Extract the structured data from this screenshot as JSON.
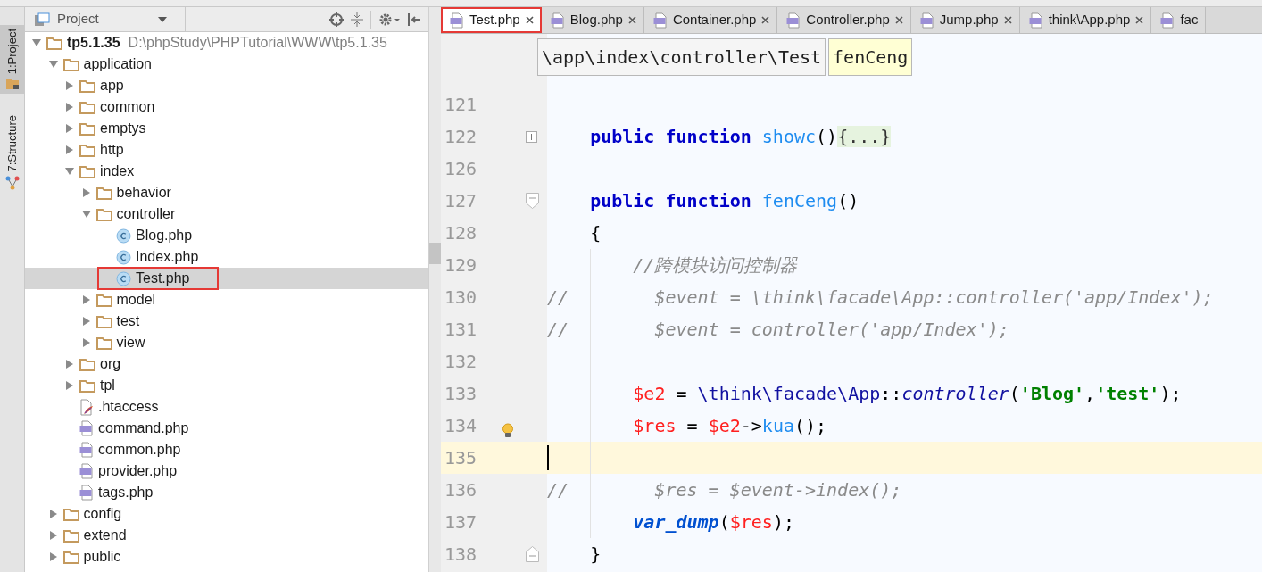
{
  "tool_strip": [
    {
      "label": "1:Project",
      "selected": true
    },
    {
      "label": "7:Structure",
      "selected": false
    }
  ],
  "project_panel": {
    "title": "Project",
    "tree": [
      {
        "name": "tp5.1.35",
        "path": "D:\\phpStudy\\PHPTutorial\\WWW\\tp5.1.35",
        "kind": "folder",
        "expanded": true,
        "selected": false,
        "children": [
          {
            "name": "application",
            "kind": "folder",
            "expanded": true,
            "selected": false,
            "children": [
              {
                "name": "app",
                "kind": "folder",
                "expanded": false,
                "selected": false
              },
              {
                "name": "common",
                "kind": "folder",
                "expanded": false,
                "selected": false
              },
              {
                "name": "emptys",
                "kind": "folder",
                "expanded": false,
                "selected": false
              },
              {
                "name": "http",
                "kind": "folder",
                "expanded": false,
                "selected": false
              },
              {
                "name": "index",
                "kind": "folder",
                "expanded": true,
                "selected": false,
                "children": [
                  {
                    "name": "behavior",
                    "kind": "folder",
                    "expanded": false,
                    "selected": false
                  },
                  {
                    "name": "controller",
                    "kind": "folder",
                    "expanded": true,
                    "selected": false,
                    "children": [
                      {
                        "name": "Blog.php",
                        "kind": "class",
                        "selected": false
                      },
                      {
                        "name": "Index.php",
                        "kind": "class",
                        "selected": false
                      },
                      {
                        "name": "Test.php",
                        "kind": "class",
                        "selected": true,
                        "annotated": true
                      }
                    ]
                  },
                  {
                    "name": "model",
                    "kind": "folder",
                    "expanded": false,
                    "selected": false
                  },
                  {
                    "name": "test",
                    "kind": "folder",
                    "expanded": false,
                    "selected": false
                  },
                  {
                    "name": "view",
                    "kind": "folder",
                    "expanded": false,
                    "selected": false
                  }
                ]
              },
              {
                "name": "org",
                "kind": "folder",
                "expanded": false,
                "selected": false
              },
              {
                "name": "tpl",
                "kind": "folder",
                "expanded": false,
                "selected": false
              },
              {
                "name": ".htaccess",
                "kind": "htaccess",
                "selected": false
              },
              {
                "name": "command.php",
                "kind": "php",
                "selected": false
              },
              {
                "name": "common.php",
                "kind": "php",
                "selected": false
              },
              {
                "name": "provider.php",
                "kind": "php",
                "selected": false
              },
              {
                "name": "tags.php",
                "kind": "php",
                "selected": false
              }
            ]
          },
          {
            "name": "config",
            "kind": "folder",
            "expanded": false,
            "selected": false
          },
          {
            "name": "extend",
            "kind": "folder",
            "expanded": false,
            "selected": false
          },
          {
            "name": "public",
            "kind": "folder",
            "expanded": false,
            "selected": false
          }
        ]
      }
    ]
  },
  "editor": {
    "tabs": [
      {
        "label": "Test.php",
        "selected": true,
        "annotated": true
      },
      {
        "label": "Blog.php",
        "selected": false,
        "annotated": false
      },
      {
        "label": "Container.php",
        "selected": false,
        "annotated": false
      },
      {
        "label": "Controller.php",
        "selected": false,
        "annotated": false
      },
      {
        "label": "Jump.php",
        "selected": false,
        "annotated": false
      },
      {
        "label": "think\\App.php",
        "selected": false,
        "annotated": false
      },
      {
        "label": "fac",
        "selected": false,
        "annotated": false
      }
    ],
    "breadcrumbs": [
      {
        "label": "\\app\\index\\controller\\Test",
        "selected": false
      },
      {
        "label": "fenCeng",
        "selected": true
      }
    ],
    "lines": [
      {
        "number": "121"
      },
      {
        "number": "122",
        "fold": {
          "kind": "collapsed"
        },
        "tokens": [
          {
            "kind": "kw",
            "text": "    public function "
          },
          {
            "kind": "fn",
            "text": "showc"
          },
          {
            "kind": "plain",
            "text": "()"
          },
          {
            "kind": "folded",
            "text": "{...}"
          }
        ]
      },
      {
        "number": "126"
      },
      {
        "number": "127",
        "fold": {
          "kind": "start"
        },
        "tokens": [
          {
            "kind": "kw",
            "text": "    public function "
          },
          {
            "kind": "fn",
            "text": "fenCeng"
          },
          {
            "kind": "plain",
            "text": "()"
          }
        ]
      },
      {
        "number": "128",
        "tokens": [
          {
            "kind": "plain",
            "text": "    {"
          }
        ]
      },
      {
        "number": "129",
        "guide": true,
        "tokens": [
          {
            "kind": "comment",
            "text": "        //跨模块访问控制器"
          }
        ]
      },
      {
        "number": "130",
        "guide": true,
        "tokens": [
          {
            "kind": "comment",
            "text": "//        $event = \\think\\facade\\App::controller('app/Index');"
          }
        ]
      },
      {
        "number": "131",
        "guide": true,
        "tokens": [
          {
            "kind": "comment",
            "text": "//        $event = controller('app/Index');"
          }
        ]
      },
      {
        "number": "132",
        "guide": true
      },
      {
        "number": "133",
        "guide": true,
        "tokens": [
          {
            "kind": "var",
            "text": "        $e2"
          },
          {
            "kind": "plain",
            "text": " = "
          },
          {
            "kind": "ns",
            "text": "\\think\\facade\\App"
          },
          {
            "kind": "plain",
            "text": "::"
          },
          {
            "kind": "call",
            "text": "controller"
          },
          {
            "kind": "plain",
            "text": "("
          },
          {
            "kind": "str",
            "text": "'Blog'"
          },
          {
            "kind": "plain",
            "text": ","
          },
          {
            "kind": "str",
            "text": "'test'"
          },
          {
            "kind": "plain",
            "text": ");"
          }
        ]
      },
      {
        "number": "134",
        "guide": true,
        "hint": true,
        "tokens": [
          {
            "kind": "var",
            "text": "        $res"
          },
          {
            "kind": "plain",
            "text": " = "
          },
          {
            "kind": "var",
            "text": "$e2"
          },
          {
            "kind": "plain",
            "text": "->"
          },
          {
            "kind": "fn",
            "text": "kua"
          },
          {
            "kind": "plain",
            "text": "();"
          }
        ]
      },
      {
        "number": "135",
        "current": true,
        "guide": true
      },
      {
        "number": "136",
        "guide": true,
        "tokens": [
          {
            "kind": "comment",
            "text": "//        $res = $event->index();"
          }
        ]
      },
      {
        "number": "137",
        "guide": true,
        "tokens": [
          {
            "kind": "builtin",
            "text": "        var_dump"
          },
          {
            "kind": "plain",
            "text": "("
          },
          {
            "kind": "var",
            "text": "$res"
          },
          {
            "kind": "plain",
            "text": ");"
          }
        ]
      },
      {
        "number": "138",
        "fold": {
          "kind": "end"
        },
        "tokens": [
          {
            "kind": "plain",
            "text": "    }"
          }
        ]
      }
    ]
  }
}
